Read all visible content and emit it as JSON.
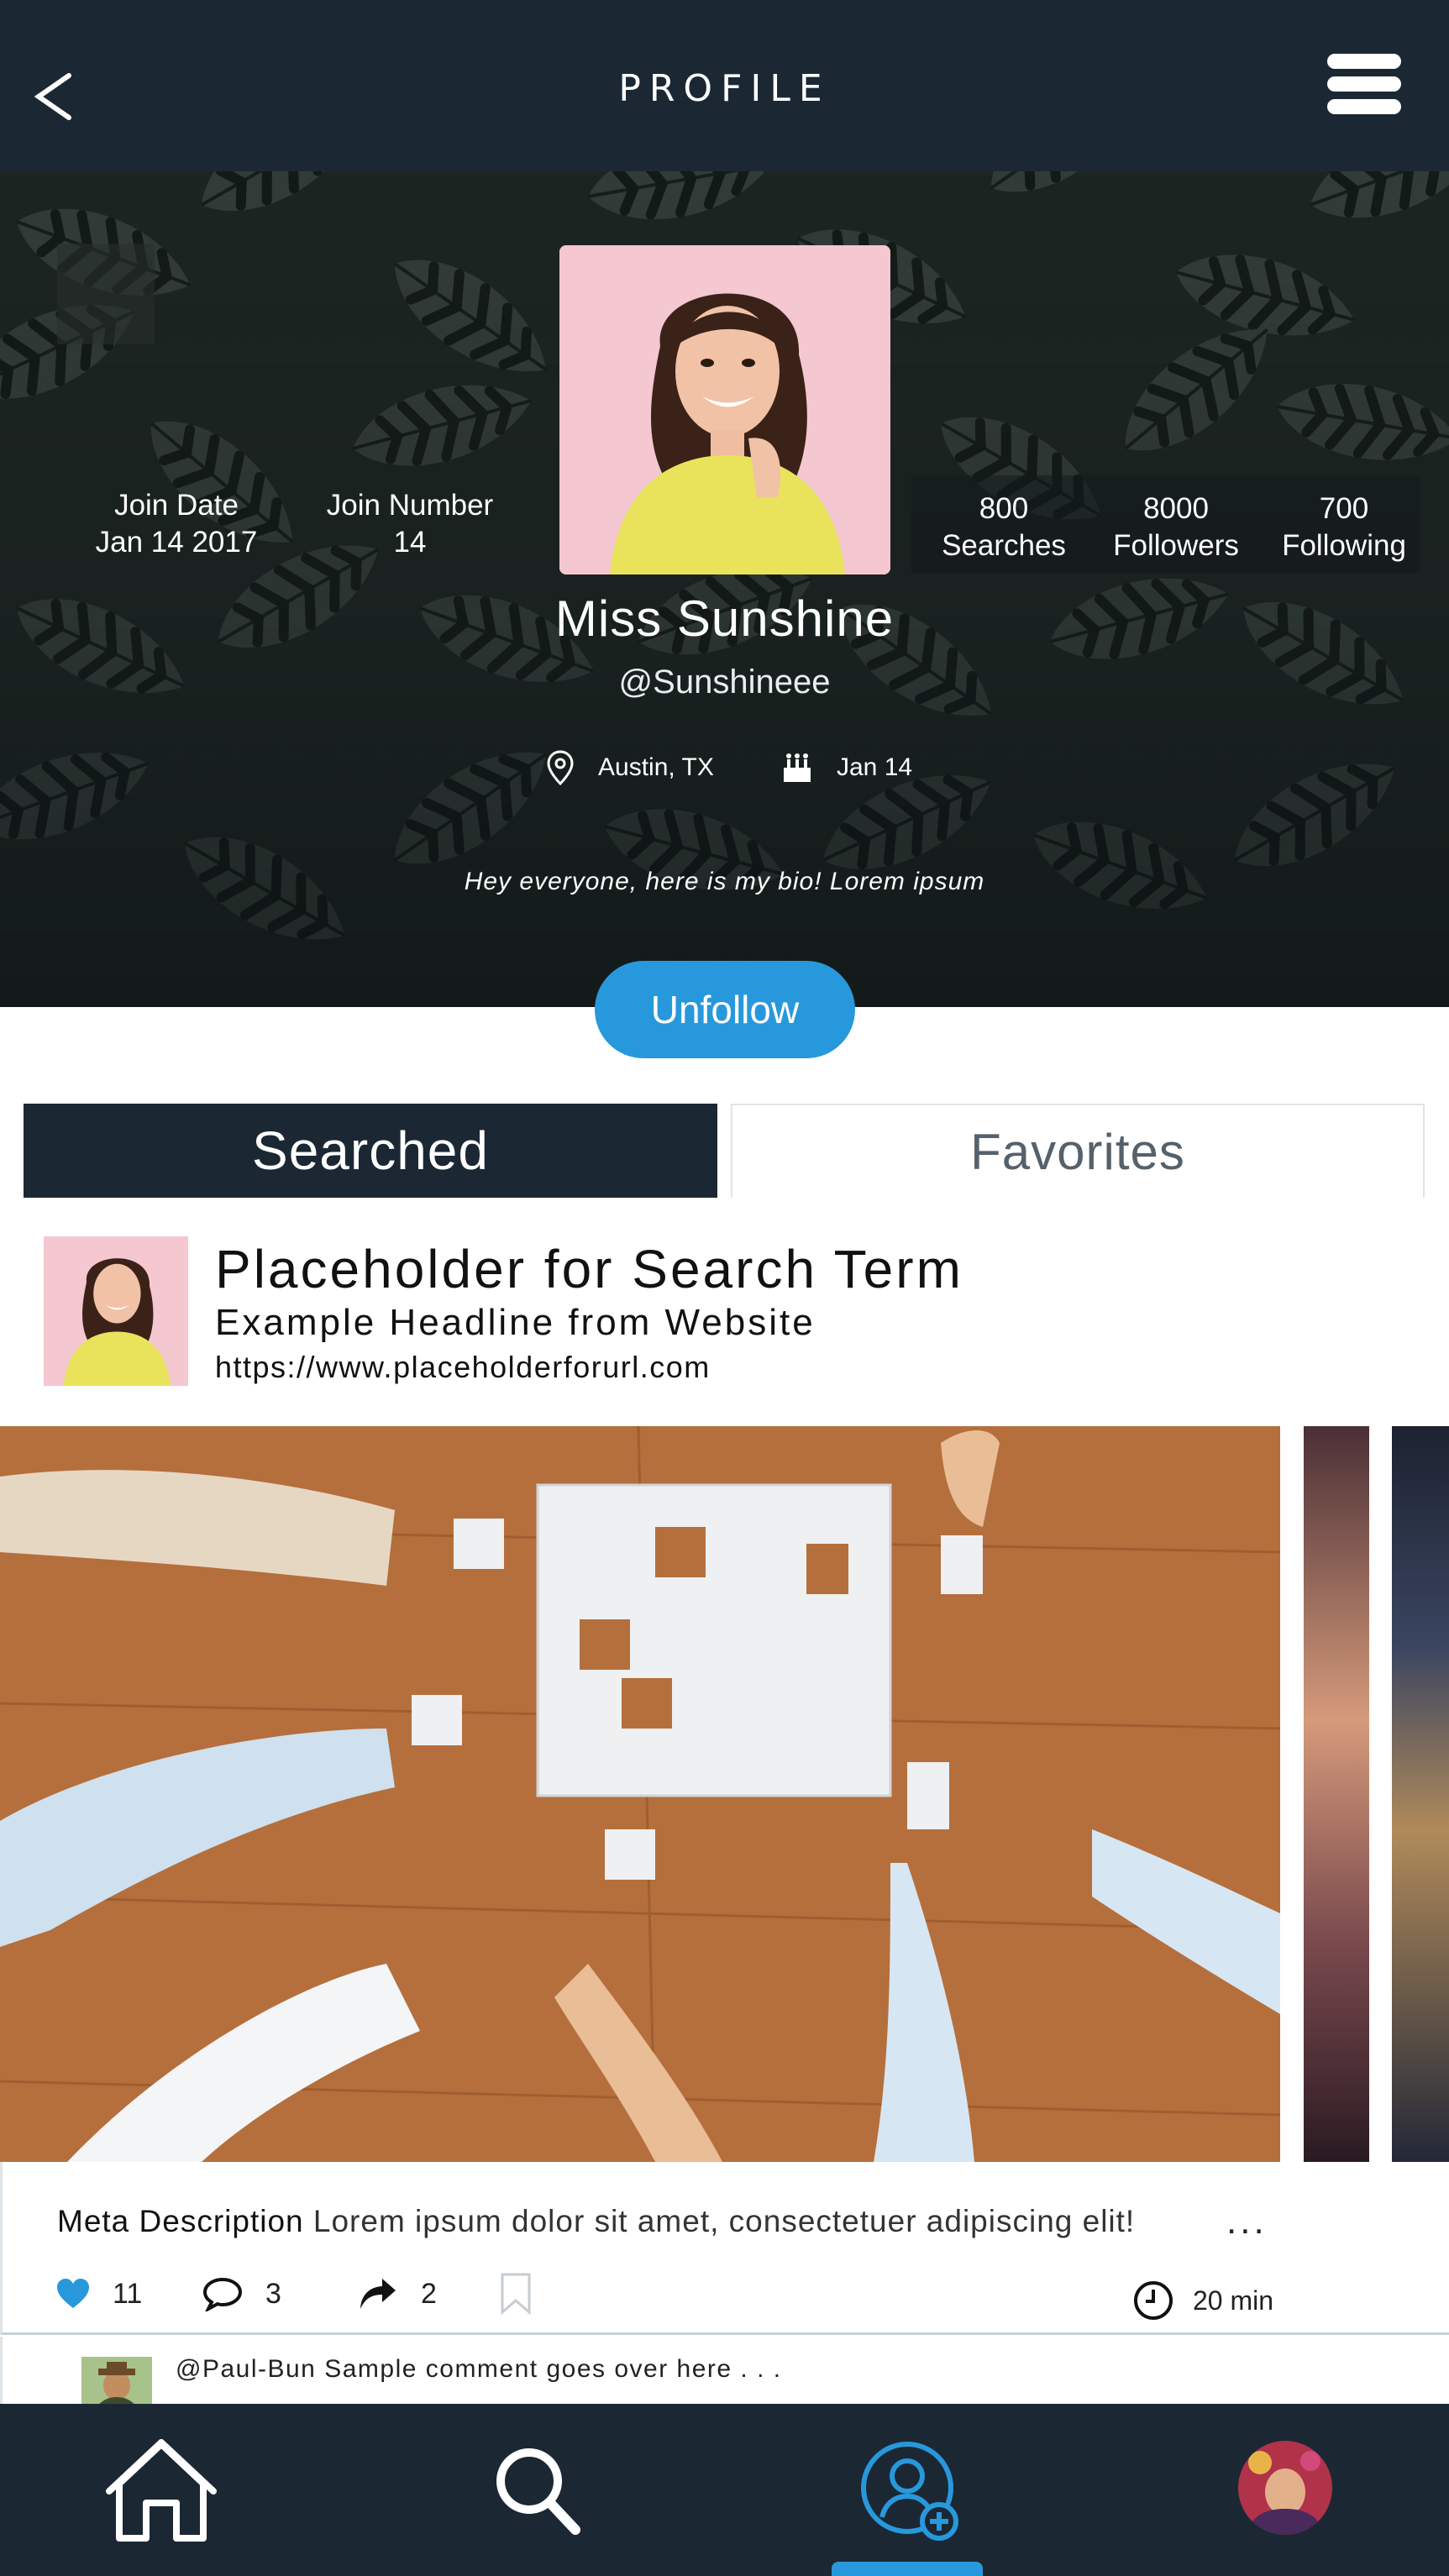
{
  "header": {
    "title": "PROFILE",
    "back_icon": "chevron-left-icon",
    "menu_icon": "hamburger-menu-icon"
  },
  "profile": {
    "join_date_label": "Join Date",
    "join_date_value": "Jan 14 2017",
    "join_number_label": "Join Number",
    "join_number_value": "14",
    "searches_value": "800",
    "searches_label": "Searches",
    "followers_value": "8000",
    "followers_label": "Followers",
    "following_value": "700",
    "following_label": "Following",
    "name": "Miss Sunshine",
    "handle": "@Sunshineee",
    "location": "Austin, TX",
    "birthday": "Jan 14",
    "bio": "Hey everyone, here is my bio! Lorem ipsum",
    "unfollow_label": "Unfollow"
  },
  "tabs": [
    {
      "label": "Searched",
      "active": true
    },
    {
      "label": "Favorites",
      "active": false
    }
  ],
  "card": {
    "search_term": "Placeholder for Search Term",
    "headline": "Example Headline from Website",
    "url": "https://www.placeholderforurl.com",
    "meta_label": "Meta Description",
    "meta_text": "Lorem ipsum dolor sit amet, consectetuer adipiscing elit!",
    "more_label": "...",
    "likes": "11",
    "comments": "3",
    "shares": "2",
    "time": "20 min"
  },
  "comment": {
    "text": "@Paul-Bun Sample comment goes over here . . ."
  },
  "nav": {
    "items": [
      "home-icon",
      "search-icon",
      "profile-add-icon",
      "avatar"
    ],
    "active": "profile-add-icon"
  },
  "colors": {
    "navy": "#1b2834",
    "accent": "#2898dc",
    "white": "#ffffff"
  }
}
